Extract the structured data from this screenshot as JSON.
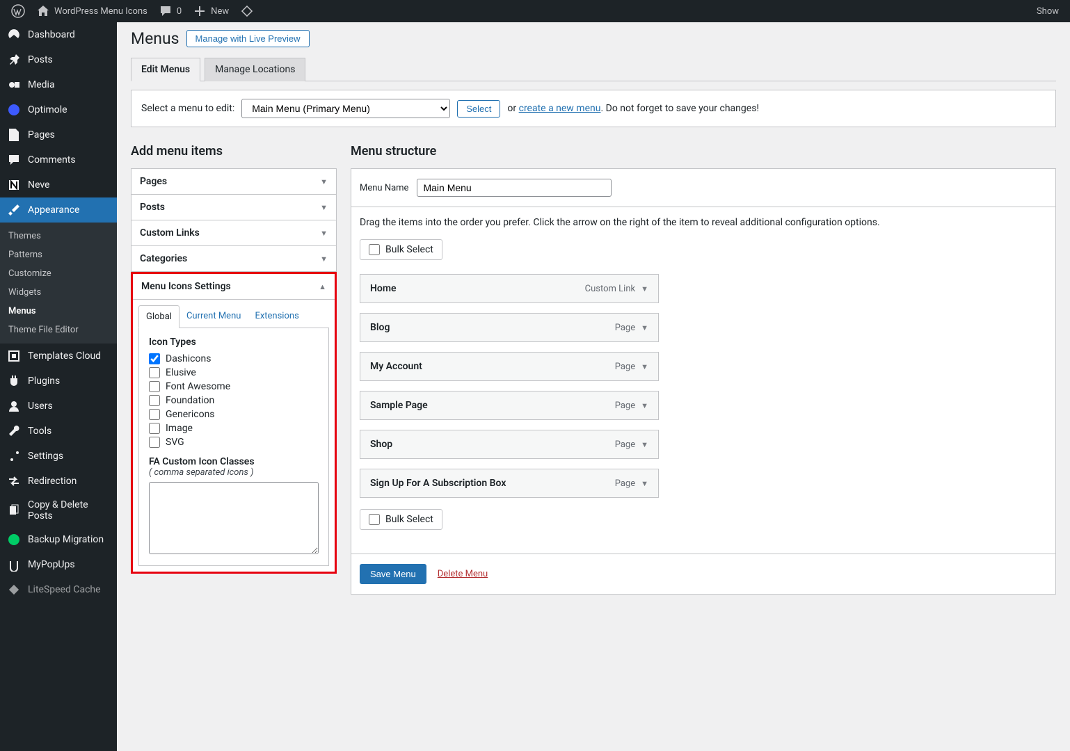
{
  "adminbar": {
    "site_title": "WordPress Menu Icons",
    "comments_count": "0",
    "new_label": "New",
    "right_label": "Show"
  },
  "sidebar": {
    "items": [
      {
        "label": "Dashboard"
      },
      {
        "label": "Posts"
      },
      {
        "label": "Media"
      },
      {
        "label": "Optimole"
      },
      {
        "label": "Pages"
      },
      {
        "label": "Comments"
      },
      {
        "label": "Neve"
      },
      {
        "label": "Appearance"
      },
      {
        "label": "Templates Cloud"
      },
      {
        "label": "Plugins"
      },
      {
        "label": "Users"
      },
      {
        "label": "Tools"
      },
      {
        "label": "Settings"
      },
      {
        "label": "Redirection"
      },
      {
        "label": "Copy & Delete Posts"
      },
      {
        "label": "Backup Migration"
      },
      {
        "label": "MyPopUps"
      },
      {
        "label": "LiteSpeed Cache"
      }
    ],
    "appearance_submenu": [
      {
        "label": "Themes"
      },
      {
        "label": "Patterns"
      },
      {
        "label": "Customize"
      },
      {
        "label": "Widgets"
      },
      {
        "label": "Menus",
        "current": true
      },
      {
        "label": "Theme File Editor"
      }
    ]
  },
  "page": {
    "title": "Menus",
    "manage_preview": "Manage with Live Preview",
    "tabs": [
      {
        "label": "Edit Menus",
        "active": true
      },
      {
        "label": "Manage Locations"
      }
    ]
  },
  "menuSelect": {
    "label": "Select a menu to edit:",
    "selected": "Main Menu (Primary Menu)",
    "select_btn": "Select",
    "or_text": "or ",
    "create_link": "create a new menu",
    "tail_text": ". Do not forget to save your changes!"
  },
  "addItems": {
    "title": "Add menu items",
    "boxes": [
      "Pages",
      "Posts",
      "Custom Links",
      "Categories"
    ],
    "icons_settings": {
      "title": "Menu Icons Settings",
      "tabs": [
        "Global",
        "Current Menu",
        "Extensions"
      ],
      "icon_types_label": "Icon Types",
      "icon_types": [
        {
          "label": "Dashicons",
          "checked": true
        },
        {
          "label": "Elusive"
        },
        {
          "label": "Font Awesome"
        },
        {
          "label": "Foundation"
        },
        {
          "label": "Genericons"
        },
        {
          "label": "Image"
        },
        {
          "label": "SVG"
        }
      ],
      "fa_label": "FA Custom Icon Classes",
      "fa_hint": "( comma separated icons )",
      "fa_value": ""
    }
  },
  "structure": {
    "title": "Menu structure",
    "menu_name_label": "Menu Name",
    "menu_name_value": "Main Menu",
    "instructions": "Drag the items into the order you prefer. Click the arrow on the right of the item to reveal additional configuration options.",
    "bulk_select": "Bulk Select",
    "items": [
      {
        "title": "Home",
        "type": "Custom Link"
      },
      {
        "title": "Blog",
        "type": "Page"
      },
      {
        "title": "My Account",
        "type": "Page"
      },
      {
        "title": "Sample Page",
        "type": "Page"
      },
      {
        "title": "Shop",
        "type": "Page"
      },
      {
        "title": "Sign Up For A Subscription Box",
        "type": "Page"
      }
    ],
    "save_btn": "Save Menu",
    "delete_link": "Delete Menu"
  }
}
